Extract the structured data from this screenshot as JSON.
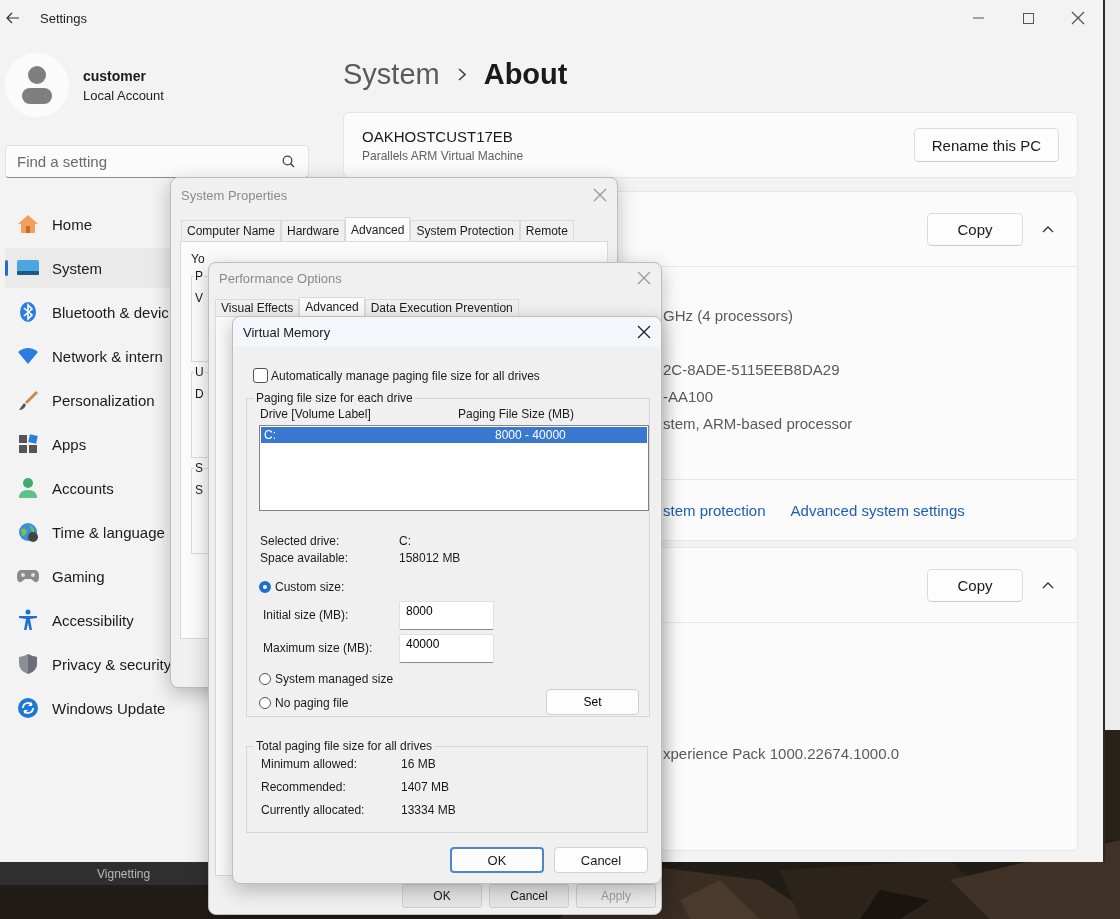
{
  "settings": {
    "title": "Settings",
    "user": {
      "name": "customer",
      "account": "Local Account"
    },
    "search": {
      "placeholder": "Find a setting"
    },
    "nav": [
      {
        "label": "Home",
        "selected": false
      },
      {
        "label": "System",
        "selected": true
      },
      {
        "label": "Bluetooth & devic",
        "selected": false
      },
      {
        "label": "Network & intern",
        "selected": false
      },
      {
        "label": "Personalization",
        "selected": false
      },
      {
        "label": "Apps",
        "selected": false
      },
      {
        "label": "Accounts",
        "selected": false
      },
      {
        "label": "Time & language",
        "selected": false
      },
      {
        "label": "Gaming",
        "selected": false
      },
      {
        "label": "Accessibility",
        "selected": false
      },
      {
        "label": "Privacy & security",
        "selected": false
      },
      {
        "label": "Windows Update",
        "selected": false
      }
    ],
    "breadcrumb": {
      "parent": "System",
      "current": "About"
    },
    "device": {
      "name": "OAKHOSTCUST17EB",
      "model": "Parallels ARM Virtual Machine",
      "rename_button": "Rename this PC"
    },
    "device_specs": {
      "copy_button": "Copy",
      "expanded": true,
      "rows": [
        "GHz  (4 processors)",
        "2C-8ADE-5115EEB8DA29",
        "-AA100",
        "stem, ARM-based processor"
      ],
      "links": [
        "stem protection",
        "Advanced system settings"
      ]
    },
    "windows_specs": {
      "copy_button": "Copy",
      "expanded": true,
      "rows": [
        "xperience Pack 1000.22674.1000.0"
      ]
    }
  },
  "system_properties": {
    "title": "System Properties",
    "tabs": [
      {
        "label": "Computer Name",
        "selected": false
      },
      {
        "label": "Hardware",
        "selected": false
      },
      {
        "label": "Advanced",
        "selected": true
      },
      {
        "label": "System Protection",
        "selected": false
      },
      {
        "label": "Remote",
        "selected": false
      }
    ],
    "intro": "Yo",
    "groups": [
      {
        "title": "P",
        "lines": [
          "V"
        ]
      },
      {
        "title": "U",
        "lines": [
          "D"
        ]
      },
      {
        "title": "S",
        "lines": [
          "S"
        ]
      }
    ]
  },
  "performance_options": {
    "title": "Performance Options",
    "tabs": [
      {
        "label": "Visual Effects",
        "selected": false
      },
      {
        "label": "Advanced",
        "selected": true
      },
      {
        "label": "Data Execution Prevention",
        "selected": false
      }
    ],
    "buttons": [
      {
        "label": "OK",
        "disabled": false
      },
      {
        "label": "Cancel",
        "disabled": false
      },
      {
        "label": "Apply",
        "disabled": true
      }
    ]
  },
  "virtual_memory": {
    "title": "Virtual Memory",
    "auto_manage": {
      "label": "Automatically manage paging file size for all drives",
      "checked": false
    },
    "group_title": "Paging file size for each drive",
    "columns": [
      "Drive  [Volume Label]",
      "Paging File Size (MB)"
    ],
    "drives": [
      {
        "drive": "C:",
        "size": "8000 - 40000",
        "selected": true
      }
    ],
    "drive_info": [
      {
        "label": "Selected drive:",
        "value": "C:"
      },
      {
        "label": "Space available:",
        "value": "158012 MB"
      }
    ],
    "options": [
      {
        "label": "Custom size:",
        "selected": true
      },
      {
        "label": "System managed size",
        "selected": false
      },
      {
        "label": "No paging file",
        "selected": false
      }
    ],
    "initial_size": {
      "label": "Initial size (MB):",
      "value": "8000"
    },
    "maximum_size": {
      "label": "Maximum size (MB):",
      "value": "40000"
    },
    "set_button": "Set",
    "totals_title": "Total paging file size for all drives",
    "totals": [
      {
        "label": "Minimum allowed:",
        "value": "16 MB"
      },
      {
        "label": "Recommended:",
        "value": "1407 MB"
      },
      {
        "label": "Currently allocated:",
        "value": "13334 MB"
      }
    ],
    "buttons": [
      {
        "label": "OK",
        "default": true
      },
      {
        "label": "Cancel",
        "default": false
      }
    ]
  },
  "background_panel": {
    "label": "Vignetting"
  }
}
